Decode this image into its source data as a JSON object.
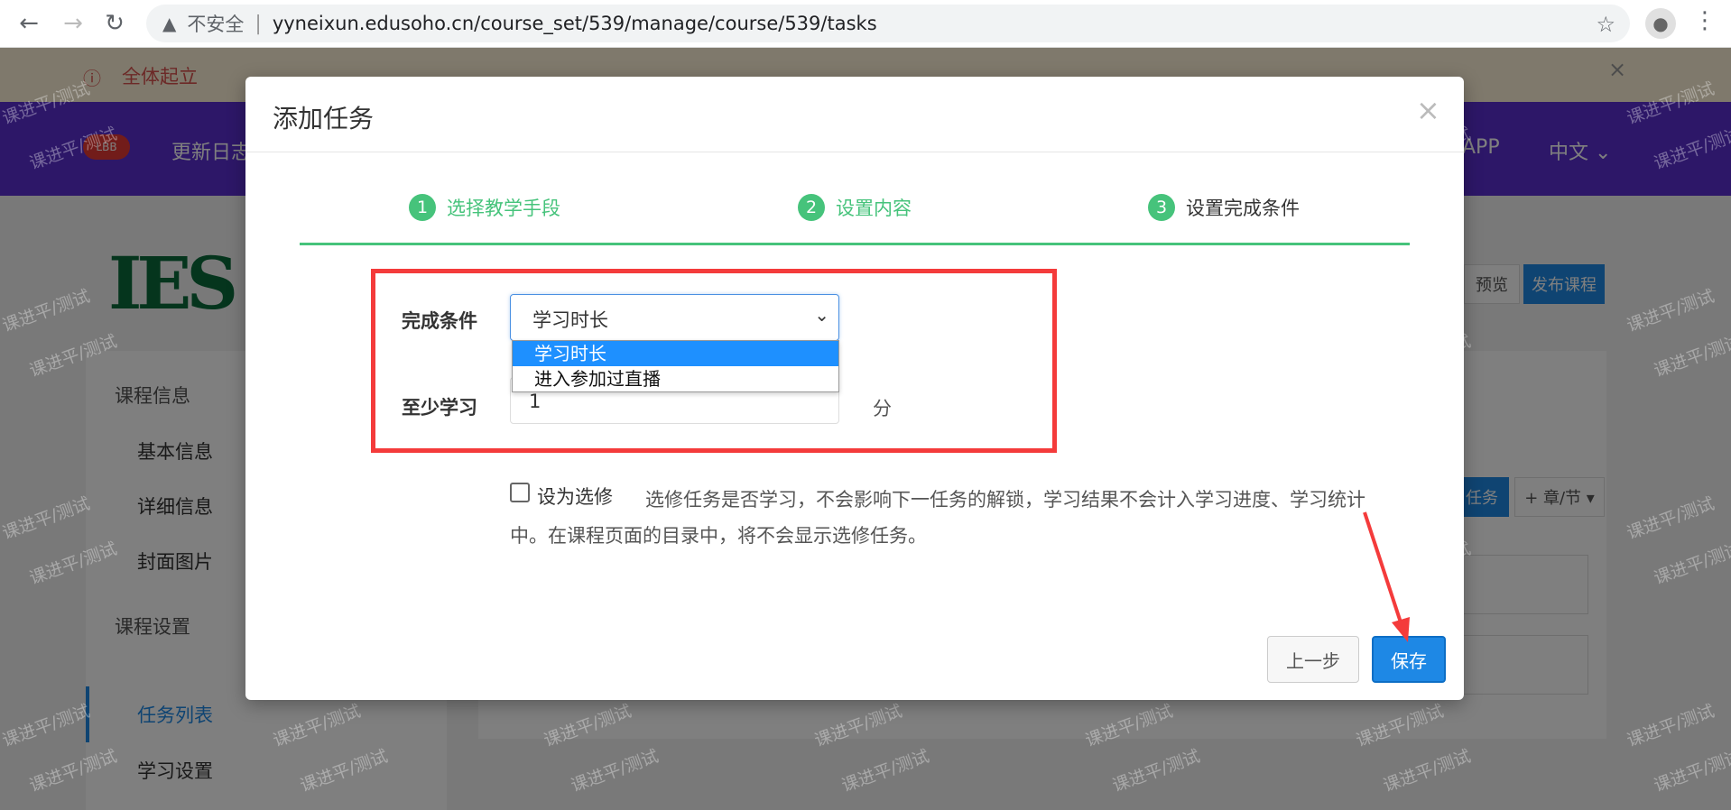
{
  "browser": {
    "insecure_label": "不安全",
    "url": "yyneixun.edusoho.cn/course_set/539/manage/course/539/tasks",
    "icons": [
      "back-icon",
      "forward-icon",
      "reload-icon",
      "warning-icon",
      "star-icon",
      "profile-icon",
      "menu-icon"
    ]
  },
  "page": {
    "alert_text": "全体起立",
    "nav_badge": "LBB",
    "nav_links": [
      "更新日志",
      "APP",
      "中文 ⌄"
    ],
    "logo_text": "IES",
    "sidebar": {
      "group1": "课程信息",
      "items1": [
        "基本信息",
        "详细信息",
        "封面图片"
      ],
      "group2": "课程设置",
      "items2": [
        "任务列表",
        "学习设置"
      ]
    },
    "preview_btn": "预览",
    "publish_btn": "发布课程",
    "task_btn": "任务",
    "chapter_btn": "+ 章/节 ▾"
  },
  "watermark": "课进平/测试",
  "modal": {
    "title": "添加任务",
    "close": "×",
    "steps": [
      {
        "num": "1",
        "label": "选择教学手段",
        "state": "done"
      },
      {
        "num": "2",
        "label": "设置内容",
        "state": "done"
      },
      {
        "num": "3",
        "label": "设置完成条件",
        "state": "current"
      }
    ],
    "complete_condition_label": "完成条件",
    "select_value": "学习时长",
    "options": [
      "学习时长",
      "进入参加过直播"
    ],
    "min_study_label": "至少学习",
    "min_study_value": "1",
    "unit": "分",
    "elective_label": "设为选修",
    "elective_desc": "选修任务是否学习，不会影响下一任务的解锁，学习结果不会计入学习进度、学习统计中。在课程页面的目录中，将不会显示选修任务。",
    "prev_btn": "上一步",
    "save_btn": "保存"
  },
  "colors": {
    "primary": "#1e88e5",
    "step_green": "#46c37b",
    "highlight_red": "#f43b3b",
    "nav_purple": "#5b2ed1"
  }
}
